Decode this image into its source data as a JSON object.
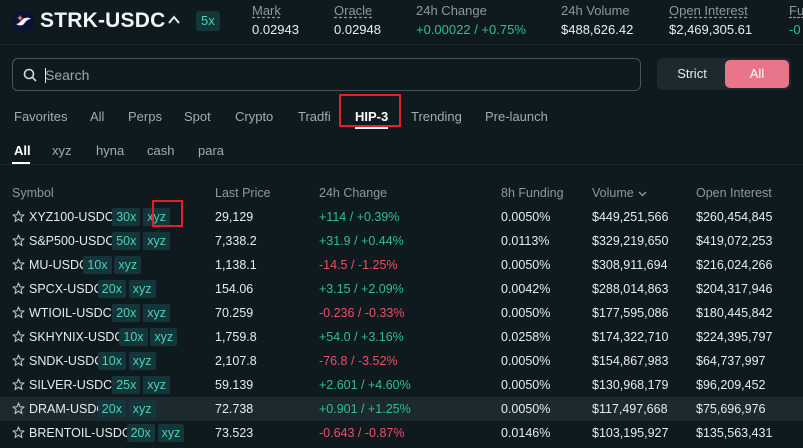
{
  "header": {
    "pair": "STRK-USDC",
    "leverage": "5x",
    "stats": [
      {
        "label": "Mark",
        "value": "0.02943"
      },
      {
        "label": "Oracle",
        "value": "0.02948"
      },
      {
        "label": "24h Change",
        "value": "+0.00022 / +0.75%"
      },
      {
        "label": "24h Volume",
        "value": "$488,626.42"
      },
      {
        "label": "Open Interest",
        "value": "$2,469,305.61"
      },
      {
        "label": "Fu",
        "value": "-0"
      }
    ]
  },
  "search": {
    "placeholder": "Search",
    "value": ""
  },
  "match_toggle": {
    "strict": "Strict",
    "all": "All",
    "selected": "All"
  },
  "tabs": [
    "Favorites",
    "All",
    "Perps",
    "Spot",
    "Crypto",
    "Tradfi",
    "HIP-3",
    "Trending",
    "Pre-launch"
  ],
  "active_tab": "HIP-3",
  "subtabs": [
    "All",
    "xyz",
    "hyna",
    "cash",
    "para"
  ],
  "active_subtab": "All",
  "columns": [
    "Symbol",
    "Last Price",
    "24h Change",
    "8h Funding",
    "Volume",
    "Open Interest"
  ],
  "sort_column": "Volume",
  "colors": {
    "accent": "#e9758a",
    "positive": "#2fbf8f",
    "negative": "#ef4e64",
    "badge_text": "#4fd1b4",
    "highlight": "#e0202a"
  },
  "rows": [
    {
      "symbol": "XYZ100-USDC",
      "lev": "30x",
      "dex": "xyz",
      "price": "29,129",
      "change": "+114 / +0.39%",
      "dir": "up",
      "funding": "0.0050%",
      "volume": "$449,251,566",
      "oi": "$260,454,845"
    },
    {
      "symbol": "S&P500-USDC",
      "lev": "50x",
      "dex": "xyz",
      "price": "7,338.2",
      "change": "+31.9 / +0.44%",
      "dir": "up",
      "funding": "0.0113%",
      "volume": "$329,219,650",
      "oi": "$419,072,253"
    },
    {
      "symbol": "MU-USDC",
      "lev": "10x",
      "dex": "xyz",
      "price": "1,138.1",
      "change": "-14.5 / -1.25%",
      "dir": "down",
      "funding": "0.0050%",
      "volume": "$308,911,694",
      "oi": "$216,024,266"
    },
    {
      "symbol": "SPCX-USDC",
      "lev": "20x",
      "dex": "xyz",
      "price": "154.06",
      "change": "+3.15 / +2.09%",
      "dir": "up",
      "funding": "0.0042%",
      "volume": "$288,014,863",
      "oi": "$204,317,946"
    },
    {
      "symbol": "WTIOIL-USDC",
      "lev": "20x",
      "dex": "xyz",
      "price": "70.259",
      "change": "-0.236 / -0.33%",
      "dir": "down",
      "funding": "0.0050%",
      "volume": "$177,595,086",
      "oi": "$180,445,842"
    },
    {
      "symbol": "SKHYNIX-USDC",
      "lev": "10x",
      "dex": "xyz",
      "price": "1,759.8",
      "change": "+54.0 / +3.16%",
      "dir": "up",
      "funding": "0.0258%",
      "volume": "$174,322,710",
      "oi": "$224,395,797"
    },
    {
      "symbol": "SNDK-USDC",
      "lev": "10x",
      "dex": "xyz",
      "price": "2,107.8",
      "change": "-76.8 / -3.52%",
      "dir": "down",
      "funding": "0.0050%",
      "volume": "$154,867,983",
      "oi": "$64,737,997"
    },
    {
      "symbol": "SILVER-USDC",
      "lev": "25x",
      "dex": "xyz",
      "price": "59.139",
      "change": "+2.601 / +4.60%",
      "dir": "up",
      "funding": "0.0050%",
      "volume": "$130,968,179",
      "oi": "$96,209,452"
    },
    {
      "symbol": "DRAM-USDC",
      "lev": "20x",
      "dex": "xyz",
      "price": "72.738",
      "change": "+0.901 / +1.25%",
      "dir": "up",
      "funding": "0.0050%",
      "volume": "$117,497,668",
      "oi": "$75,696,976"
    },
    {
      "symbol": "BRENTOIL-USDC",
      "lev": "20x",
      "dex": "xyz",
      "price": "73.523",
      "change": "-0.643 / -0.87%",
      "dir": "down",
      "funding": "0.0146%",
      "volume": "$103,195,927",
      "oi": "$135,563,431"
    }
  ]
}
